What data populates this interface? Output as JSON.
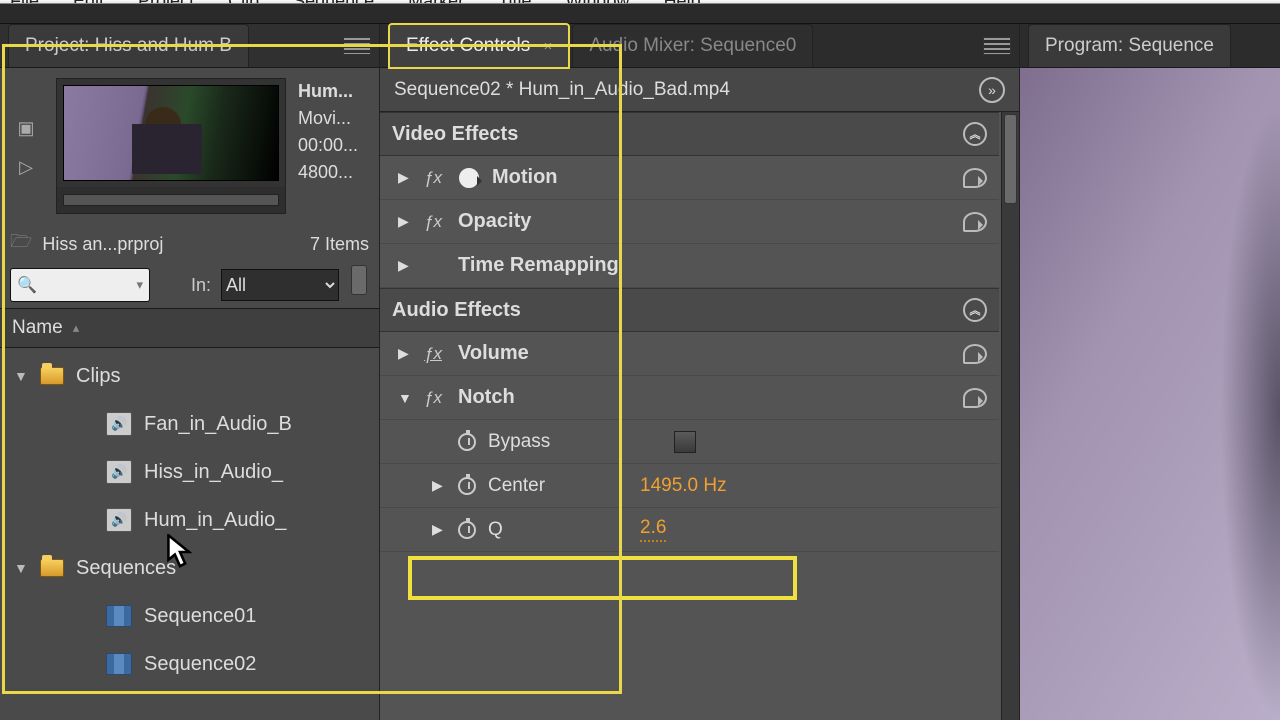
{
  "menubar": [
    "File",
    "Edit",
    "Project",
    "Clip",
    "Sequence",
    "Marker",
    "Title",
    "Window",
    "Help"
  ],
  "project": {
    "tab_title": "Project: Hiss and Hum B",
    "clip_name": "Hum...",
    "clip_type": "Movi...",
    "clip_tc": "00:00...",
    "clip_rate": "4800...",
    "proj_file": "Hiss an...prproj",
    "item_count": "7 Items",
    "in_label": "In:",
    "in_value": "All",
    "name_col": "Name"
  },
  "tree": {
    "clips_folder": "Clips",
    "clip1": "Fan_in_Audio_B",
    "clip2": "Hiss_in_Audio_",
    "clip3": "Hum_in_Audio_",
    "seq_folder": "Sequences",
    "seq1": "Sequence01",
    "seq2": "Sequence02"
  },
  "effect_controls": {
    "tab": "Effect Controls",
    "tab2": "Audio Mixer: Sequence0",
    "breadcrumb": "Sequence02 * Hum_in_Audio_Bad.mp4",
    "video_effects": "Video Effects",
    "motion": "Motion",
    "opacity": "Opacity",
    "time_remap": "Time Remapping",
    "audio_effects": "Audio Effects",
    "volume": "Volume",
    "notch": "Notch",
    "bypass": "Bypass",
    "center": "Center",
    "center_val": "1495.0 Hz",
    "q": "Q",
    "q_val": "2.6"
  },
  "right": {
    "tab": "Program: Sequence"
  }
}
